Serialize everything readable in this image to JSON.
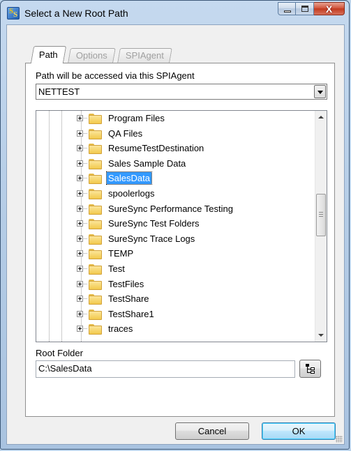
{
  "window": {
    "title": "Select a New Root Path"
  },
  "caption": {
    "close_label": "X"
  },
  "tabs": [
    {
      "label": "Path",
      "active": true
    },
    {
      "label": "Options",
      "active": false
    },
    {
      "label": "SPIAgent",
      "active": false
    }
  ],
  "agent": {
    "label": "Path will be accessed via this SPIAgent",
    "selected": "NETTEST"
  },
  "tree": {
    "items": [
      {
        "label": "Program Files",
        "selected": false
      },
      {
        "label": "QA Files",
        "selected": false
      },
      {
        "label": "ResumeTestDestination",
        "selected": false
      },
      {
        "label": "Sales Sample Data",
        "selected": false
      },
      {
        "label": "SalesData",
        "selected": true
      },
      {
        "label": "spoolerlogs",
        "selected": false
      },
      {
        "label": "SureSync Performance Testing",
        "selected": false
      },
      {
        "label": "SureSync Test Folders",
        "selected": false
      },
      {
        "label": "SureSync Trace Logs",
        "selected": false
      },
      {
        "label": "TEMP",
        "selected": false
      },
      {
        "label": "Test",
        "selected": false
      },
      {
        "label": "TestFiles",
        "selected": false
      },
      {
        "label": "TestShare",
        "selected": false
      },
      {
        "label": "TestShare1",
        "selected": false
      },
      {
        "label": "traces",
        "selected": false
      }
    ],
    "scroll_position": 0.58
  },
  "root": {
    "label": "Root Folder",
    "value": "C:\\SalesData"
  },
  "buttons": {
    "cancel": "Cancel",
    "ok": "OK"
  },
  "colors": {
    "selection": "#3399ff",
    "folder": "#f2c94c",
    "close_button": "#c23a1f"
  }
}
